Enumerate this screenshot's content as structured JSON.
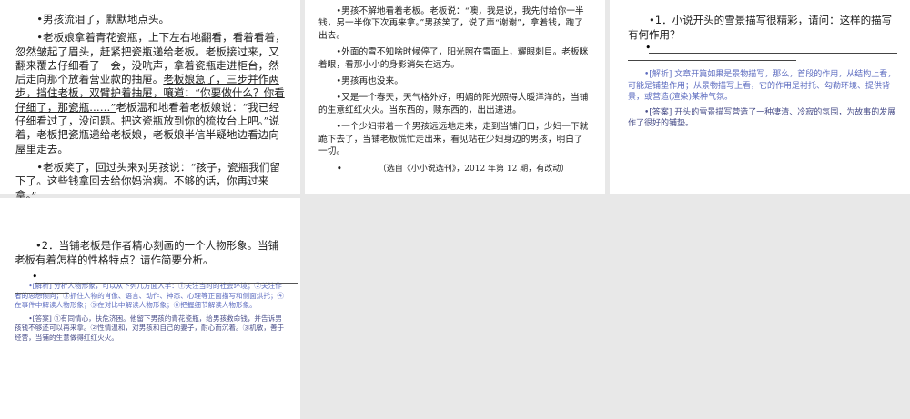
{
  "slide1": {
    "p1": "•男孩流泪了，默默地点头。",
    "p2a": "•老板娘拿着青花瓷瓶，上下左右地翻看，看着看着，忽然皱起了眉头，赶紧把瓷瓶递给老板。老板接过来，又翻来覆去仔细看了一会，没吭声，拿着瓷瓶走进柜台，然后走向那个放着营业款的抽屉。",
    "p2b": "老板娘急了，三步并作两步，挡住老板，双臂护着抽屉，嚷道：“你要做什么？你看仔细了，那瓷瓶……”",
    "p2c": "老板温和地看着老板娘说：“我已经仔细看过了，没问题。把这瓷瓶放到你的梳妆台上吧。”说着，老板把瓷瓶递给老板娘，老板娘半信半疑地边看边向屋里走去。",
    "p3": "•老板笑了，回过头来对男孩说：“孩子，瓷瓶我们留下了。这些钱拿回去给你妈治病。不够的话，你再过来拿。”"
  },
  "slide2": {
    "p1": "•男孩不解地看着老板。老板说：“噢，我是说，我先付给你一半钱，另一半你下次再来拿。”男孩笑了，说了声“谢谢”，拿着钱，跑了出去。",
    "p2": "•外面的雪不知啥时候停了，阳光照在雪面上，耀眼刺目。老板眯着眼，看那小小的身影消失在远方。",
    "p3": "•男孩再也没来。",
    "p4": "•又是一个春天，天气格外好，明媚的阳光照得人暖洋洋的，当铺的生意红红火火。当东西的，赎东西的，出出进进。",
    "p5": "•一个少妇带着一个男孩远远地走来，走到当铺门口，少妇一下就跪下去了，当铺老板慌忙走出来，看见站在少妇身边的男孩，明白了一切。",
    "bullet": "•",
    "source": "（选自《小小说选刊》，2012 年第 12 期，有改动）"
  },
  "slide3": {
    "question": "•1．小说开头的雪景描写很精彩，请问：这样的描写有何作用？",
    "bullet": "•",
    "analysis": "•[解析] 文章开篇如果是景物描写，那么，首段的作用，从结构上看，可能是铺垫作用；从景物描写上看，它的作用是衬托、勾勒环境、提供背景，或营造(渲染)某种气氛。",
    "answer": "•[答案] 开头的雪景描写营造了一种凄清、冷寂的氛围，为故事的发展作了很好的铺垫。"
  },
  "slide4": {
    "question": "•2．当铺老板是作者精心刻画的一个人物形象。当铺老板有着怎样的性格特点？请作简要分析。",
    "bullet": "•",
    "analysis": "•[解析] 分析人物形象，可以从下列几方面入手：①关注当时的社会环境；②关注作者的思想倾向；③抓住人物的肖像、语言、动作、神态、心理等正面描写和侧面烘托；④在事件中解读人物形象；⑤在对比中解读人物形象；⑥把握细节解读人物形象。",
    "answer": "•[答案] ①有同情心，扶危济困。他留下男孩的青花瓷瓶，给男孩救命钱，并告诉男孩钱不够还可以再来拿。②性情温和，对男孩和自己的妻子，耐心而沉着。③机敏，善于经营，当铺的生意做得红红火火。"
  }
}
